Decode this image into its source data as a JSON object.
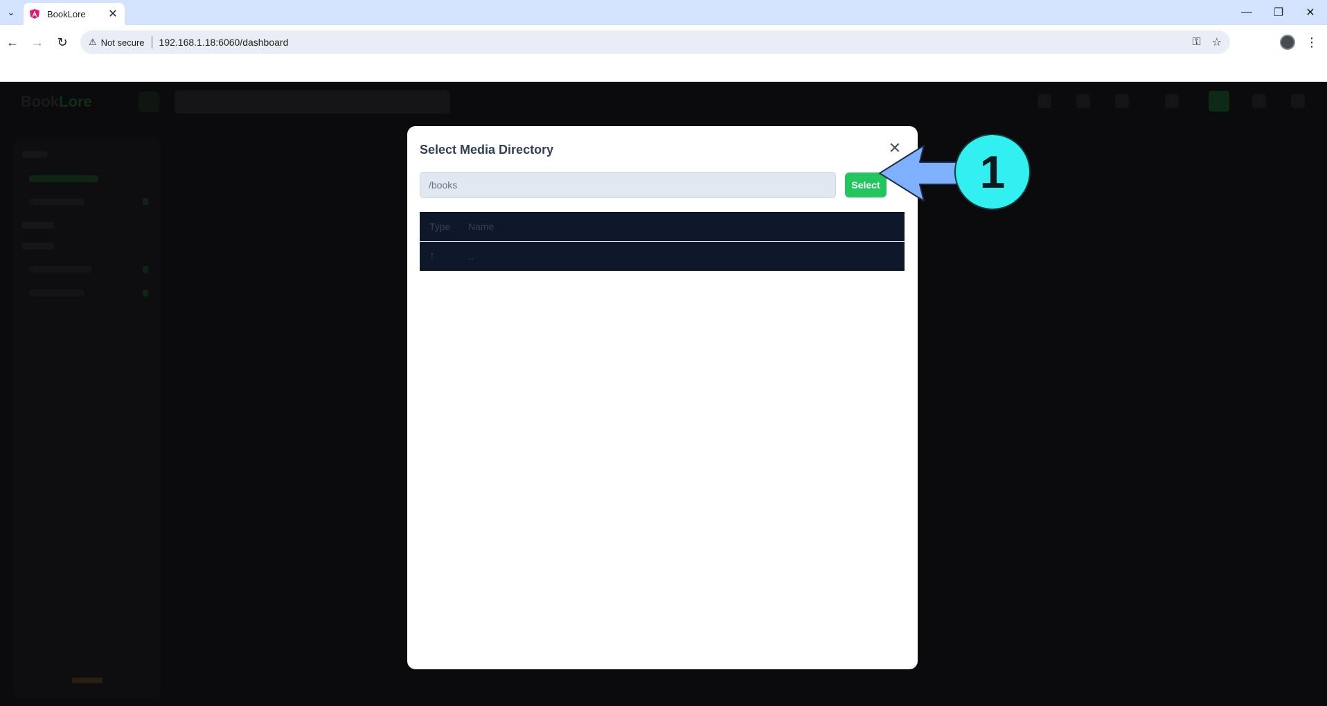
{
  "browser": {
    "tab_title": "BookLore",
    "security_label": "Not secure",
    "url": "192.168.1.18:6060/dashboard"
  },
  "app": {
    "logo_text": "Book",
    "logo_accent": "Lore"
  },
  "dialog": {
    "title": "Select Media Directory",
    "path_value": "/books",
    "select_label": "Select",
    "columns": [
      "Type",
      "Name"
    ],
    "rows": [
      {
        "type_icon": "↑",
        "name": ".."
      }
    ]
  },
  "annotation": {
    "step_number": "1"
  },
  "colors": {
    "accent_green": "#22c55e",
    "badge_cyan": "#33f0f0",
    "arrow_blue": "#7fb0ff",
    "table_header": "#0f172a"
  },
  "icons": [
    "tab-list-icon",
    "angular-favicon-icon",
    "close-icon",
    "minimize-icon",
    "restore-icon",
    "back-arrow-icon",
    "forward-arrow-icon",
    "reload-icon",
    "warning-icon",
    "key-icon",
    "star-icon",
    "kebab-menu-icon",
    "up-arrow-icon"
  ]
}
